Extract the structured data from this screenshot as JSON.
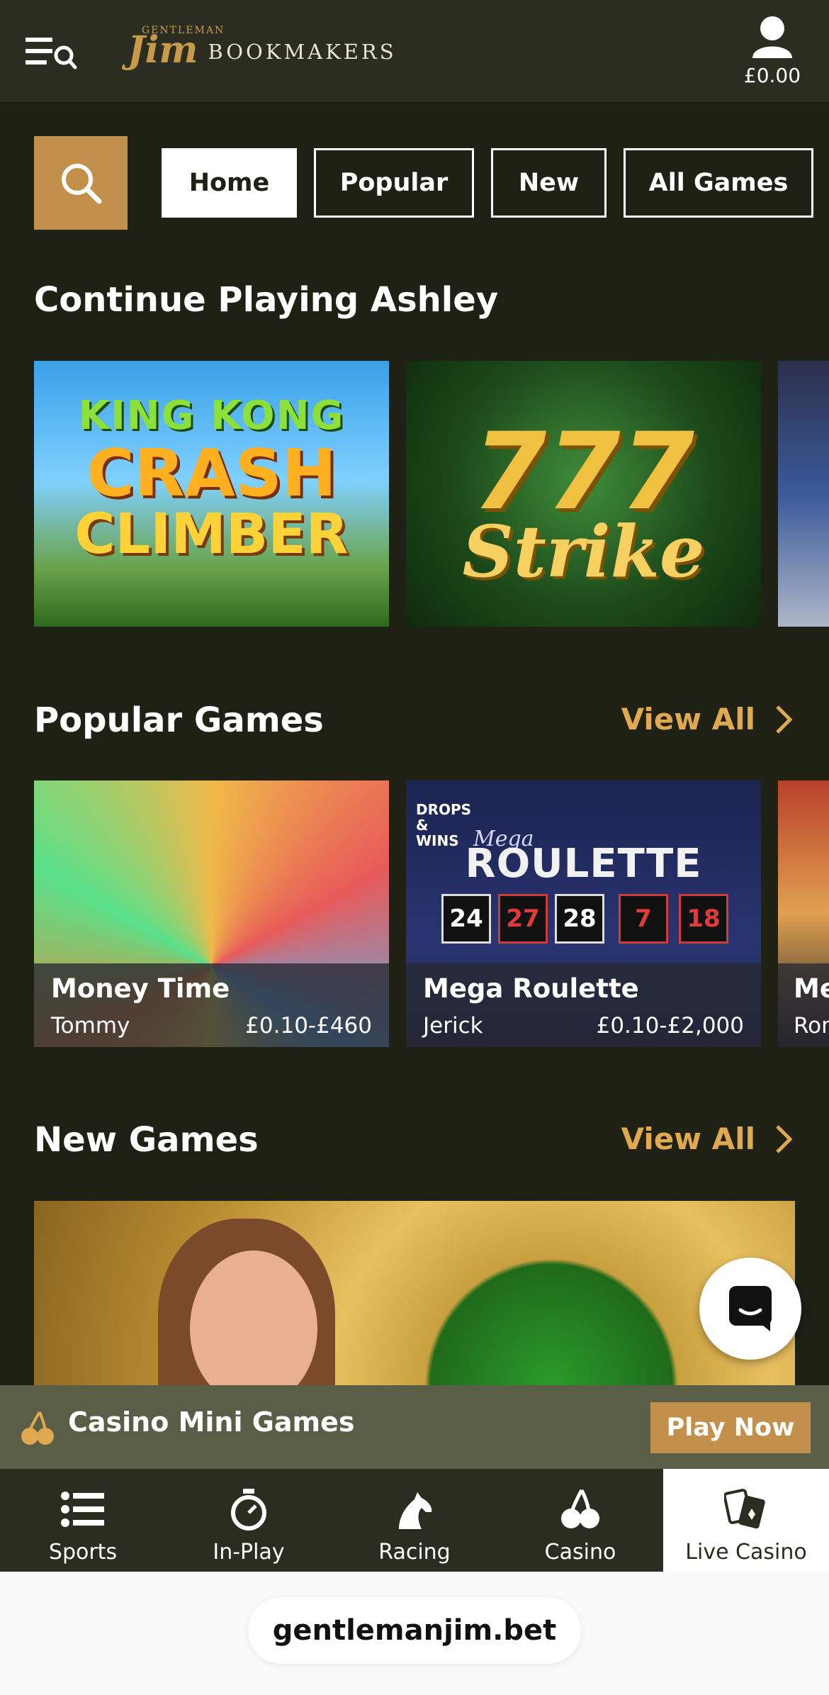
{
  "header": {
    "logo_small": "GENTLEMAN",
    "logo_name": "Jim",
    "logo_word": "BOOKMAKERS",
    "balance": "£0.00",
    "icons": {
      "menu": "menu-search-icon",
      "account": "user-icon"
    }
  },
  "filters": {
    "search_icon": "search-icon",
    "tabs": [
      {
        "label": "Home",
        "active": true
      },
      {
        "label": "Popular",
        "active": false
      },
      {
        "label": "New",
        "active": false
      },
      {
        "label": "All Games",
        "active": false
      }
    ]
  },
  "continue": {
    "title": "Continue Playing Ashley",
    "games": [
      {
        "line1": "KING KONG",
        "line2": "CRASH",
        "line3": "CLIMBER"
      },
      {
        "num": "777",
        "word": "Strike"
      }
    ]
  },
  "popular": {
    "title": "Popular Games",
    "view_all": "View All",
    "games": [
      {
        "name": "Money Time",
        "dealer": "Tommy",
        "limits": "£0.10-£460"
      },
      {
        "name": "Mega Roulette",
        "dealer": "Jerick",
        "limits": "£0.10-£2,000",
        "badge": "DROPS & WINS",
        "mega": "Mega",
        "title": "ROULETTE",
        "numbers": [
          "24",
          "27",
          "28",
          "7",
          "18"
        ]
      },
      {
        "name": "Me",
        "dealer": "Ror"
      }
    ]
  },
  "new_games": {
    "title": "New Games",
    "view_all": "View All"
  },
  "mini_games": {
    "label": "Casino Mini Games",
    "button": "Play Now",
    "icon": "cherries-icon"
  },
  "bottom_nav": [
    {
      "label": "Sports",
      "icon": "list-icon",
      "active": false
    },
    {
      "label": "In-Play",
      "icon": "stopwatch-icon",
      "active": false
    },
    {
      "label": "Racing",
      "icon": "horse-icon",
      "active": false
    },
    {
      "label": "Casino",
      "icon": "cherries-icon",
      "active": false
    },
    {
      "label": "Live Casino",
      "icon": "cards-icon",
      "active": true
    }
  ],
  "browser": {
    "url": "gentlemanjim.bet"
  },
  "colors": {
    "background": "#1e2114",
    "accent": "#c2904a",
    "link": "#e0a94f",
    "bar": "#2a2d1f",
    "banner": "#5a5e46"
  }
}
